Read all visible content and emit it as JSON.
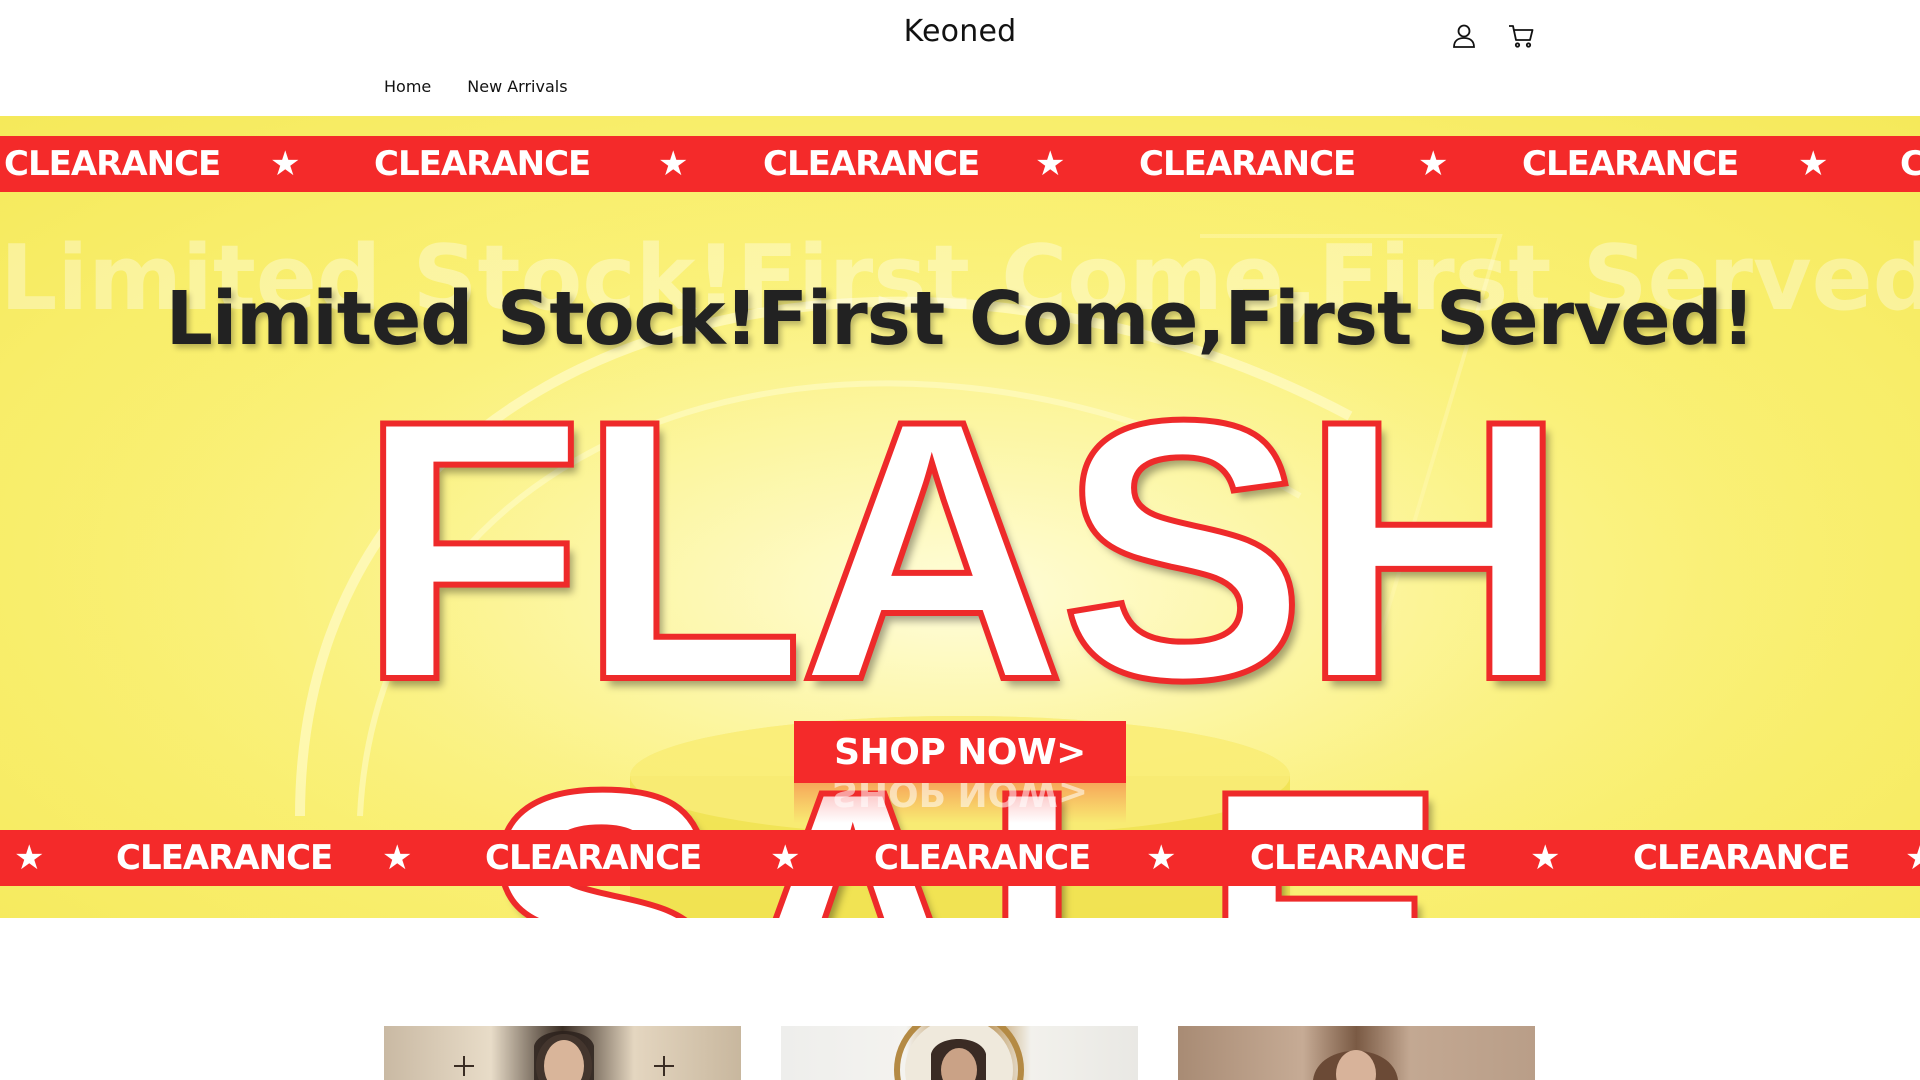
{
  "header": {
    "logo": "Keoned",
    "account_icon": "account-icon",
    "cart_icon": "cart-icon"
  },
  "nav": {
    "items": [
      {
        "label": "Home"
      },
      {
        "label": "New Arrivals"
      }
    ]
  },
  "banner": {
    "ribbon_word": "CLEARANCE",
    "ribbon_star": "★",
    "ghost_line": "Limited Stock!First Come,First Served!",
    "headline": "Limited Stock!First Come,First Served!",
    "title": "FLASH SALE",
    "cta": "SHOP NOW>",
    "colors": {
      "ribbon": "#f42a2a",
      "background": "#f8ee6a",
      "title_fill": "#ffffff",
      "title_outline": "#ee2a2a"
    }
  },
  "products": {
    "cards": [
      {
        "name": "product-card-1"
      },
      {
        "name": "product-card-2"
      },
      {
        "name": "product-card-3"
      }
    ]
  }
}
